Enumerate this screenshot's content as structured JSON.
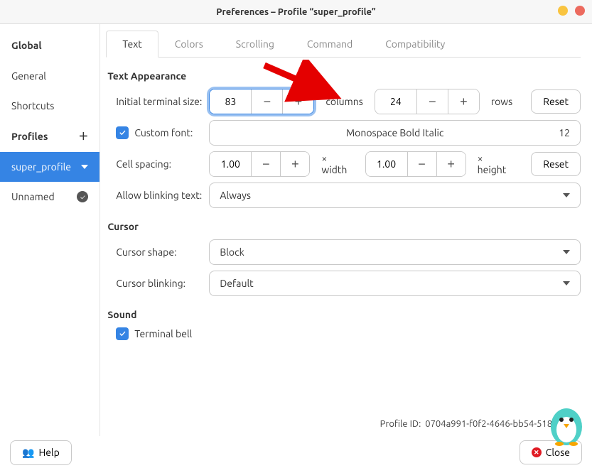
{
  "window": {
    "title": "Preferences – Profile “super_profile”"
  },
  "sidebar": {
    "global_heading": "Global",
    "items": [
      {
        "label": "General"
      },
      {
        "label": "Shortcuts"
      }
    ],
    "profiles_heading": "Profiles",
    "profiles": [
      {
        "label": "super_profile",
        "selected": true
      },
      {
        "label": "Unnamed",
        "default": true
      }
    ]
  },
  "tabs": {
    "text": "Text",
    "colors": "Colors",
    "scrolling": "Scrolling",
    "command": "Command",
    "compatibility": "Compatibility"
  },
  "sections": {
    "text_appearance": "Text Appearance",
    "cursor": "Cursor",
    "sound": "Sound"
  },
  "text": {
    "initial_size_label": "Initial terminal size:",
    "columns_value": "83",
    "columns_unit": "columns",
    "rows_value": "24",
    "rows_unit": "rows",
    "reset": "Reset",
    "custom_font_label": "Custom font:",
    "font_name": "Monospace Bold Italic",
    "font_size": "12",
    "cell_spacing_label": "Cell spacing:",
    "cell_w": "1.00",
    "cell_w_unit": "× width",
    "cell_h": "1.00",
    "cell_h_unit": "× height",
    "allow_blink_label": "Allow blinking text:",
    "allow_blink_value": "Always"
  },
  "cursor": {
    "shape_label": "Cursor shape:",
    "shape_value": "Block",
    "blink_label": "Cursor blinking:",
    "blink_value": "Default"
  },
  "sound": {
    "bell_label": "Terminal bell"
  },
  "profile_id": {
    "label": "Profile ID:",
    "value": "0704a991-f0f2-4646-bb54-518f5ba7"
  },
  "footer": {
    "help": "Help",
    "close": "Close"
  }
}
